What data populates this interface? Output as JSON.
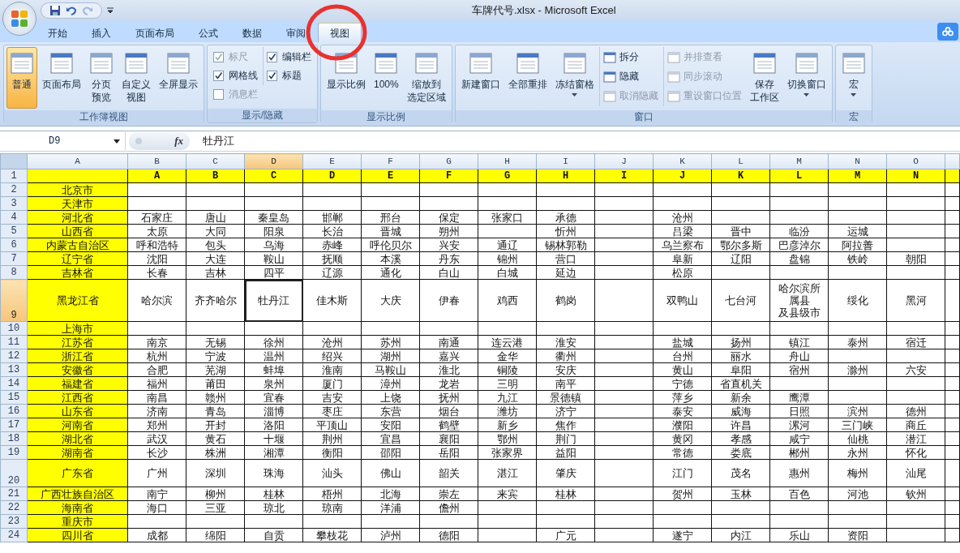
{
  "window": {
    "title": "车牌代号.xlsx  -  Microsoft Excel"
  },
  "quick_access": [
    {
      "kind": "save",
      "disabled": false
    },
    {
      "kind": "undo",
      "disabled": false
    },
    {
      "kind": "redo",
      "disabled": true
    }
  ],
  "tabs": [
    {
      "label": "开始",
      "selected": false
    },
    {
      "label": "插入",
      "selected": false
    },
    {
      "label": "页面布局",
      "selected": false
    },
    {
      "label": "公式",
      "selected": false
    },
    {
      "label": "数据",
      "selected": false
    },
    {
      "label": "审阅",
      "selected": false
    },
    {
      "label": "视图",
      "selected": true
    }
  ],
  "ribbon": {
    "groups": [
      {
        "label": "工作簿视图",
        "items": [
          {
            "kind": "large",
            "label": "普通",
            "selected": true
          },
          {
            "kind": "large",
            "label": "页面布局",
            "selected": false
          },
          {
            "kind": "large",
            "label": [
              "分页",
              "预览"
            ],
            "selected": false
          },
          {
            "kind": "large",
            "label": [
              "自定义",
              "视图"
            ],
            "selected": false
          },
          {
            "kind": "large",
            "label": "全屏显示",
            "selected": false
          }
        ]
      },
      {
        "label": "显示/隐藏",
        "items": [
          {
            "kind": "stack",
            "items": [
              {
                "kind": "check",
                "label": "标尺",
                "checked": true,
                "disabled": true
              },
              {
                "kind": "check",
                "label": "网格线",
                "checked": true,
                "disabled": false
              },
              {
                "kind": "check",
                "label": "消息栏",
                "checked": false,
                "disabled": true
              }
            ]
          },
          {
            "kind": "stack",
            "items": [
              {
                "kind": "check",
                "label": "编辑栏",
                "checked": true,
                "disabled": false
              },
              {
                "kind": "check",
                "label": "标题",
                "checked": true,
                "disabled": false
              }
            ]
          }
        ]
      },
      {
        "label": "显示比例",
        "items": [
          {
            "kind": "large",
            "label": "显示比例",
            "selected": false
          },
          {
            "kind": "large",
            "label": "100%",
            "selected": false
          },
          {
            "kind": "large",
            "label": [
              "缩放到",
              "选定区域"
            ],
            "selected": false
          }
        ]
      },
      {
        "label": "窗口",
        "items": [
          {
            "kind": "large",
            "label": "新建窗口",
            "selected": false
          },
          {
            "kind": "large",
            "label": "全部重排",
            "selected": false
          },
          {
            "kind": "large",
            "label": "冻结窗格",
            "selected": false,
            "dropdown": true
          },
          {
            "kind": "stack",
            "items": [
              {
                "kind": "small",
                "label": "拆分",
                "disabled": false
              },
              {
                "kind": "small",
                "label": "隐藏",
                "disabled": false
              },
              {
                "kind": "small",
                "label": "取消隐藏",
                "disabled": true
              }
            ]
          },
          {
            "kind": "stack",
            "items": [
              {
                "kind": "small",
                "label": "并排查看",
                "disabled": true
              },
              {
                "kind": "small",
                "label": "同步滚动",
                "disabled": true
              },
              {
                "kind": "small",
                "label": "重设窗口位置",
                "disabled": true
              }
            ]
          },
          {
            "kind": "large",
            "label": [
              "保存",
              "工作区"
            ],
            "selected": false
          },
          {
            "kind": "large",
            "label": "切换窗口",
            "selected": false,
            "dropdown": true
          }
        ]
      },
      {
        "label": "宏",
        "items": [
          {
            "kind": "large",
            "label": "宏",
            "selected": false,
            "dropdown": true
          }
        ]
      }
    ]
  },
  "formula_bar": {
    "name_box": "D9",
    "fx": "fx",
    "value": "牡丹江"
  },
  "sheet": {
    "columns": [
      {
        "label": "A",
        "selected": false
      },
      {
        "label": "B",
        "selected": false
      },
      {
        "label": "C",
        "selected": false
      },
      {
        "label": "D",
        "selected": true
      },
      {
        "label": "E",
        "selected": false
      },
      {
        "label": "F",
        "selected": false
      },
      {
        "label": "G",
        "selected": false
      },
      {
        "label": "H",
        "selected": false
      },
      {
        "label": "I",
        "selected": false
      },
      {
        "label": "J",
        "selected": false
      },
      {
        "label": "K",
        "selected": false
      },
      {
        "label": "L",
        "selected": false
      },
      {
        "label": "M",
        "selected": false
      },
      {
        "label": "N",
        "selected": false
      },
      {
        "label": "O",
        "selected": false
      }
    ],
    "rows": [
      {
        "number": "1",
        "selected": false,
        "color": "#ffff00",
        "cells": [
          null,
          "A",
          "B",
          "C",
          "D",
          "E",
          "F",
          "G",
          "H",
          "I",
          "J",
          "K",
          "L",
          "M",
          "N"
        ]
      },
      {
        "number": "2",
        "selected": false,
        "cells": [
          "北京市",
          null,
          null,
          null,
          null,
          null,
          null,
          null,
          null,
          null,
          null,
          null,
          null,
          null,
          null
        ]
      },
      {
        "number": "3",
        "selected": false,
        "cells": [
          "天津市",
          null,
          null,
          null,
          null,
          null,
          null,
          null,
          null,
          null,
          null,
          null,
          null,
          null,
          null
        ]
      },
      {
        "number": "4",
        "selected": false,
        "cells": [
          "河北省",
          "石家庄",
          "唐山",
          "秦皇岛",
          "邯郸",
          "邢台",
          "保定",
          "张家口",
          "承德",
          null,
          "沧州",
          null,
          null,
          null,
          null
        ]
      },
      {
        "number": "5",
        "selected": false,
        "cells": [
          "山西省",
          "太原",
          "大同",
          "阳泉",
          "长治",
          "晋城",
          "朔州",
          null,
          "忻州",
          null,
          "吕梁",
          "晋中",
          "临汾",
          "运城",
          null
        ]
      },
      {
        "number": "6",
        "selected": false,
        "cells": [
          "内蒙古自治区",
          "呼和浩特",
          "包头",
          "乌海",
          "赤峰",
          "呼伦贝尔",
          "兴安",
          "通辽",
          "锡林郭勒",
          null,
          "乌兰察布",
          "鄂尔多斯",
          "巴彦淖尔",
          "阿拉善",
          null
        ]
      },
      {
        "number": "7",
        "selected": false,
        "cells": [
          "辽宁省",
          "沈阳",
          "大连",
          "鞍山",
          "抚顺",
          "本溪",
          "丹东",
          "锦州",
          "营口",
          null,
          "阜新",
          "辽阳",
          "盘锦",
          "铁岭",
          "朝阳"
        ]
      },
      {
        "number": "8",
        "selected": false,
        "cells": [
          "吉林省",
          "长春",
          "吉林",
          "四平",
          "辽源",
          "通化",
          "白山",
          "白城",
          "延边",
          null,
          "松原",
          null,
          null,
          null,
          null
        ]
      },
      {
        "number": "9",
        "selected": true,
        "cells": [
          "黑龙江省",
          "哈尔滨",
          "齐齐哈尔",
          "牡丹江",
          "佳木斯",
          "大庆",
          "伊春",
          "鸡西",
          "鹤岗",
          null,
          "双鸭山",
          "七台河",
          [
            "哈尔滨所",
            "属县",
            "及县级市"
          ],
          "绥化",
          "黑河"
        ]
      },
      {
        "number": "10",
        "selected": false,
        "cells": [
          "上海市",
          null,
          null,
          null,
          null,
          null,
          null,
          null,
          null,
          null,
          null,
          null,
          null,
          null,
          null
        ]
      },
      {
        "number": "11",
        "selected": false,
        "cells": [
          "江苏省",
          "南京",
          "无锡",
          "徐州",
          "沧州",
          "苏州",
          "南通",
          "连云港",
          "淮安",
          null,
          "盐城",
          "扬州",
          "镇江",
          "泰州",
          "宿迁"
        ]
      },
      {
        "number": "12",
        "selected": false,
        "cells": [
          "浙江省",
          "杭州",
          "宁波",
          "温州",
          "绍兴",
          "湖州",
          "嘉兴",
          "金华",
          "衢州",
          null,
          "台州",
          "丽水",
          "舟山",
          null,
          null
        ]
      },
      {
        "number": "13",
        "selected": false,
        "cells": [
          "安徽省",
          "合肥",
          "芜湖",
          "蚌埠",
          "淮南",
          "马鞍山",
          "淮北",
          "铜陵",
          "安庆",
          null,
          "黄山",
          "阜阳",
          "宿州",
          "滁州",
          "六安"
        ]
      },
      {
        "number": "14",
        "selected": false,
        "cells": [
          "福建省",
          "福州",
          "莆田",
          "泉州",
          "厦门",
          "漳州",
          "龙岩",
          "三明",
          "南平",
          null,
          "宁德",
          "省直机关",
          null,
          null,
          null
        ]
      },
      {
        "number": "15",
        "selected": false,
        "cells": [
          "江西省",
          "南昌",
          "赣州",
          "宜春",
          "吉安",
          "上饶",
          "抚州",
          "九江",
          "景德镇",
          null,
          "萍乡",
          "新余",
          "鹰潭",
          null,
          null
        ]
      },
      {
        "number": "16",
        "selected": false,
        "cells": [
          "山东省",
          "济南",
          "青岛",
          "淄博",
          "枣庄",
          "东营",
          "烟台",
          "潍坊",
          "济宁",
          null,
          "泰安",
          "威海",
          "日照",
          "滨州",
          "德州"
        ]
      },
      {
        "number": "17",
        "selected": false,
        "cells": [
          "河南省",
          "郑州",
          "开封",
          "洛阳",
          "平顶山",
          "安阳",
          "鹤壁",
          "新乡",
          "焦作",
          null,
          "濮阳",
          "许昌",
          "漯河",
          "三门峡",
          "商丘"
        ]
      },
      {
        "number": "18",
        "selected": false,
        "cells": [
          "湖北省",
          "武汉",
          "黄石",
          "十堰",
          "荆州",
          "宜昌",
          "襄阳",
          "鄂州",
          "荆门",
          null,
          "黄冈",
          "孝感",
          "咸宁",
          "仙桃",
          "潜江"
        ]
      },
      {
        "number": "19",
        "selected": false,
        "cells": [
          "湖南省",
          "长沙",
          "株洲",
          "湘潭",
          "衡阳",
          "邵阳",
          "岳阳",
          "张家界",
          "益阳",
          null,
          "常德",
          "娄底",
          "郴州",
          "永州",
          "怀化"
        ]
      },
      {
        "number": "20",
        "selected": false,
        "cells": [
          "广东省",
          "广州",
          "深圳",
          "珠海",
          "汕头",
          "佛山",
          "韶关",
          "湛江",
          "肇庆",
          null,
          "江门",
          "茂名",
          "惠州",
          "梅州",
          "汕尾"
        ]
      },
      {
        "number": "21",
        "selected": false,
        "cells": [
          "广西壮族自治区",
          "南宁",
          "柳州",
          "桂林",
          "梧州",
          "北海",
          "崇左",
          "来宾",
          "桂林",
          null,
          "贺州",
          "玉林",
          "百色",
          "河池",
          "钦州"
        ]
      },
      {
        "number": "22",
        "selected": false,
        "cells": [
          "海南省",
          "海口",
          "三亚",
          "琼北",
          "琼南",
          "洋浦",
          "儋州",
          null,
          null,
          null,
          null,
          null,
          null,
          null,
          null
        ]
      },
      {
        "number": "23",
        "selected": false,
        "cells": [
          "重庆市",
          null,
          null,
          null,
          null,
          null,
          null,
          null,
          null,
          null,
          null,
          null,
          null,
          null,
          null
        ]
      },
      {
        "number": "24",
        "selected": false,
        "cells": [
          "四川省",
          "成都",
          "绵阳",
          "自贡",
          "攀枝花",
          "泸州",
          "德阳",
          null,
          "广元",
          null,
          "遂宁",
          "内江",
          "乐山",
          "资阳",
          null
        ]
      }
    ]
  }
}
